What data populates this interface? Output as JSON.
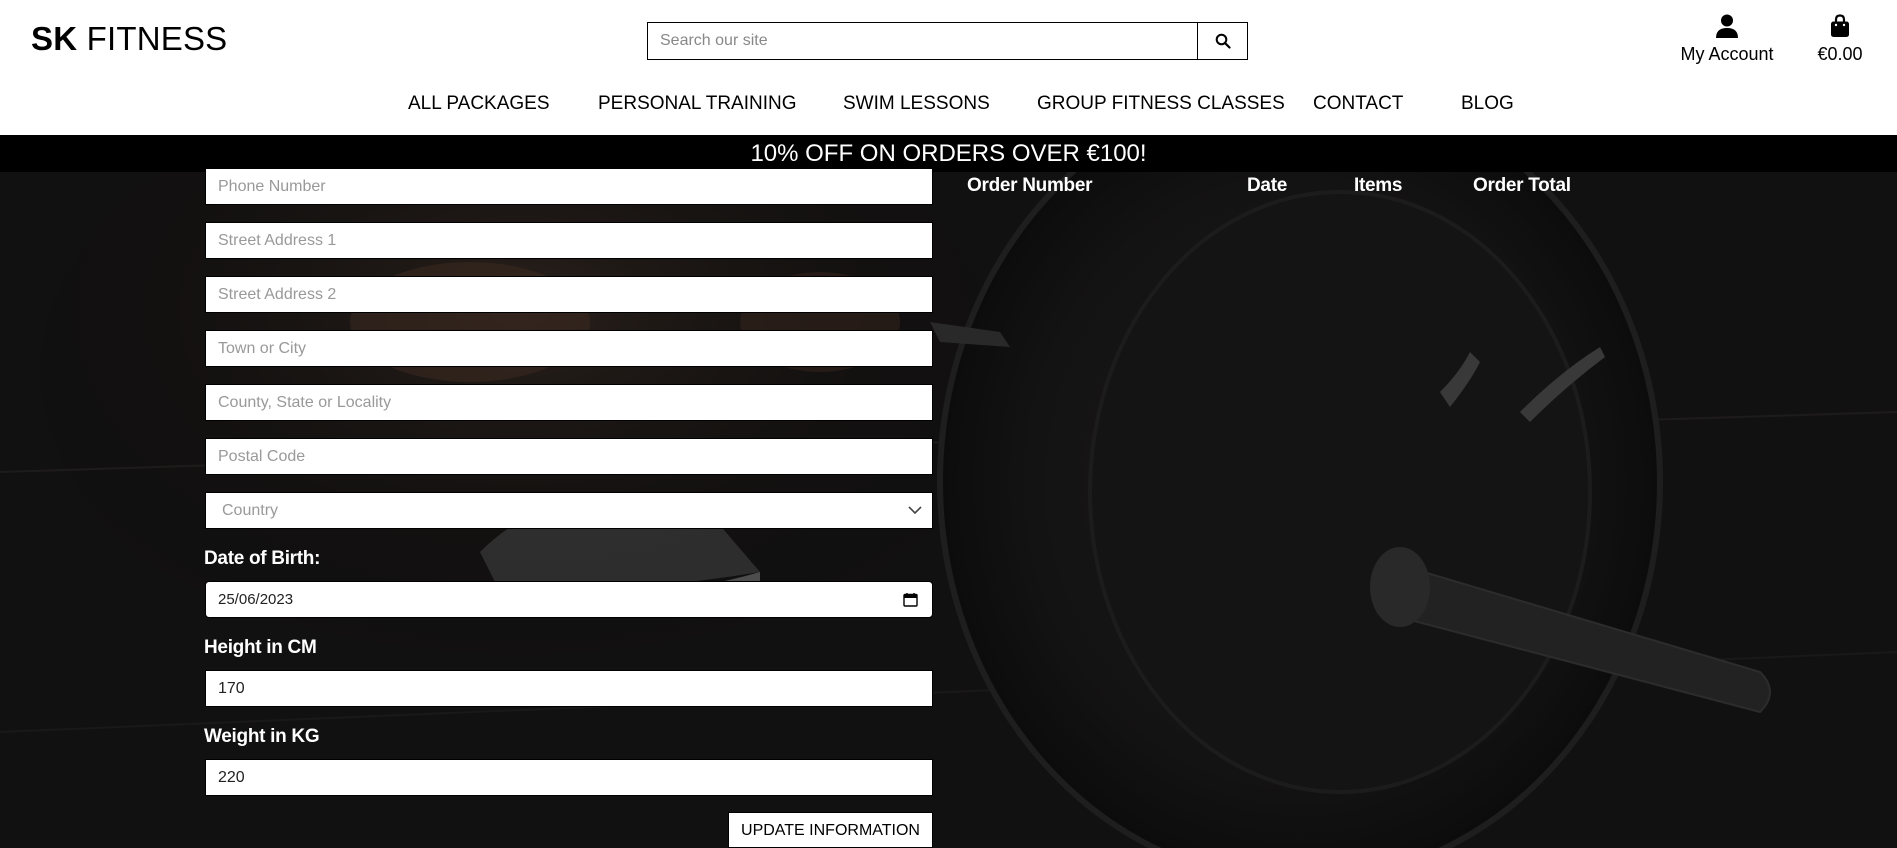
{
  "header": {
    "logo_bold": "SK",
    "logo_rest": " FITNESS",
    "search_placeholder": "Search our site",
    "account_label": "My Account",
    "cart_total": "€0.00"
  },
  "nav": {
    "items": [
      "ALL PACKAGES",
      "PERSONAL TRAINING",
      "SWIM LESSONS",
      "GROUP FITNESS CLASSES",
      "CONTACT",
      "BLOG"
    ]
  },
  "promo": {
    "text": "10% OFF ON ORDERS OVER €100!"
  },
  "form": {
    "phone_placeholder": "Phone Number",
    "street1_placeholder": "Street Address 1",
    "street2_placeholder": "Street Address 2",
    "town_placeholder": "Town or City",
    "county_placeholder": "County, State or Locality",
    "postcode_placeholder": "Postal Code",
    "country_placeholder": "Country",
    "dob_label": "Date of Birth:",
    "dob_value": "25/06/2023",
    "height_label": "Height in CM",
    "height_value": "170",
    "weight_label": "Weight in KG",
    "weight_value": "220",
    "update_button": "UPDATE INFORMATION"
  },
  "orders": {
    "columns": [
      "Order Number",
      "Date",
      "Items",
      "Order Total"
    ]
  },
  "icons": {
    "search": "search-icon",
    "account": "user-icon",
    "cart": "shopping-bag-icon",
    "country_dropdown": "chevron-down-icon",
    "date_picker": "calendar-icon"
  }
}
